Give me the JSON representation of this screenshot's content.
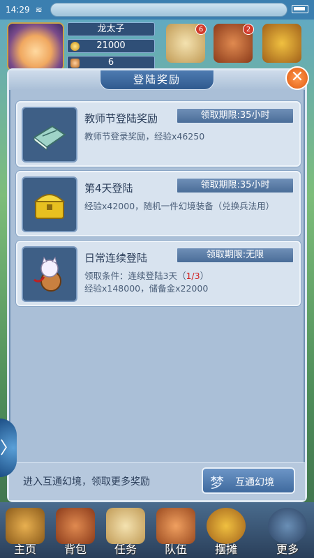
{
  "status": {
    "time": "14:29",
    "wifi_icon": "wifi-icon",
    "battery_icon": "battery-icon"
  },
  "player": {
    "name": "龙太子",
    "gold": "21000",
    "gems": "6"
  },
  "top_badges": {
    "scroll": "6",
    "chest": "2"
  },
  "modal": {
    "title": "登陆奖励",
    "close_icon": "close-icon",
    "items": [
      {
        "name": "教师节登陆奖励",
        "limit": "领取期限:35小时",
        "desc": "教师节登录奖励，经验x46250",
        "icon": "book-icon"
      },
      {
        "name": "第4天登陆",
        "limit": "领取期限:35小时",
        "desc": "经验x42000，随机一件幻境装备（兑换兵法用）",
        "icon": "treasure-chest-icon"
      },
      {
        "name": "日常连续登陆",
        "limit": "领取期限:无限",
        "desc_prefix": "领取条件：连续登陆3天（",
        "progress": "1/3",
        "desc_suffix": "）",
        "desc2": "经验x148000，储备金x22000",
        "icon": "lucky-cat-icon"
      }
    ],
    "footer_text": "进入互通幻境，领取更多奖励",
    "portal_button": "互通幻境",
    "portal_icon_glyph": "梦"
  },
  "side_arrow_glyph": "〉",
  "bottom_nav": [
    {
      "label": "主页",
      "icon": "home-icon"
    },
    {
      "label": "背包",
      "icon": "bag-icon"
    },
    {
      "label": "任务",
      "icon": "quest-scroll-icon"
    },
    {
      "label": "队伍",
      "icon": "team-icon"
    },
    {
      "label": "摆摊",
      "icon": "market-icon"
    },
    {
      "label": "更多",
      "icon": "more-icon"
    }
  ]
}
